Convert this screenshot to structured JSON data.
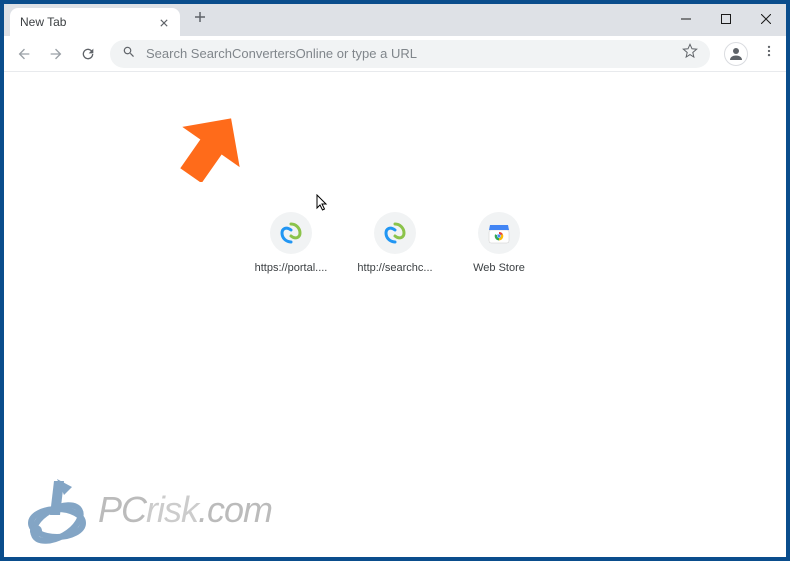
{
  "tab": {
    "title": "New Tab"
  },
  "omnibox": {
    "placeholder": "Search SearchConvertersOnline or type a URL"
  },
  "shortcuts": [
    {
      "label": "https://portal...."
    },
    {
      "label": "http://searchc..."
    },
    {
      "label": "Web Store"
    }
  ],
  "watermark": {
    "text_pc": "PC",
    "text_risk": "risk",
    "text_dom": ".com"
  }
}
